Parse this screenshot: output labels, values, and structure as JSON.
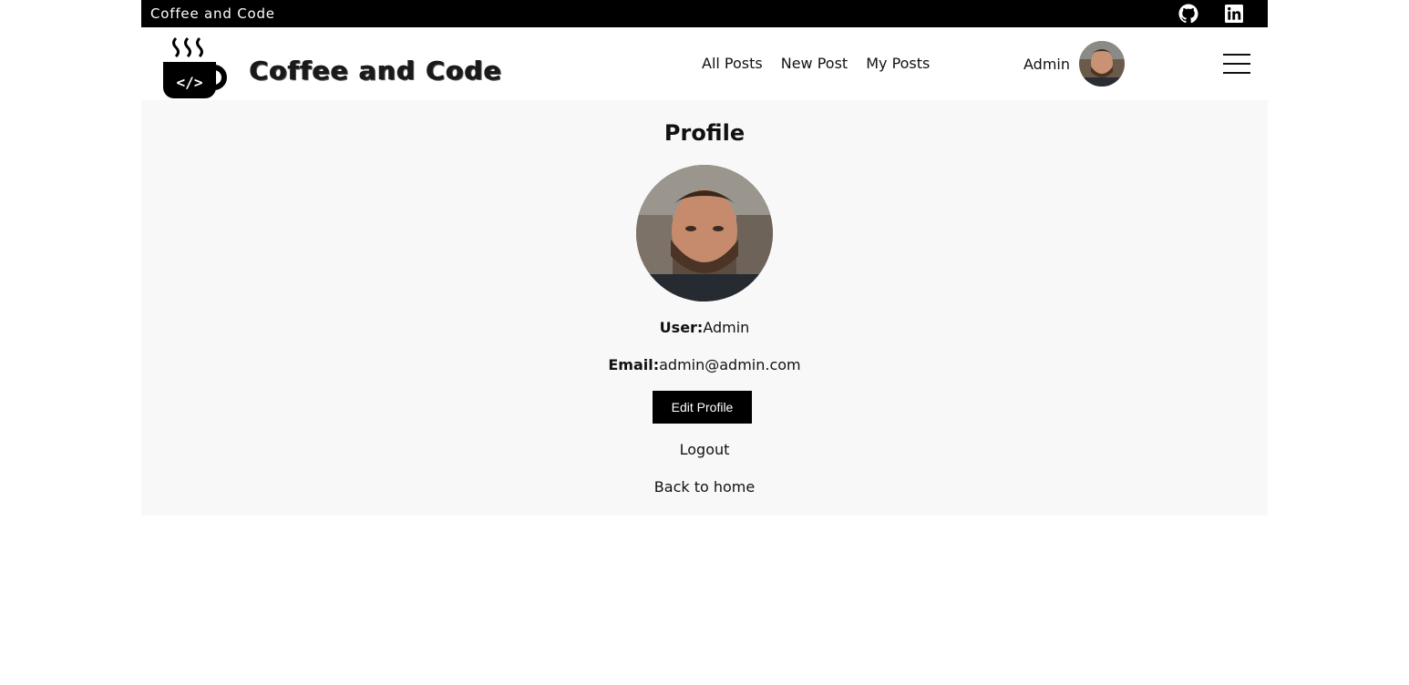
{
  "topbar": {
    "title": "Coffee and Code",
    "icons": [
      "github-icon",
      "linkedin-icon"
    ]
  },
  "header": {
    "brand": "Coffee and Code",
    "nav": [
      "All Posts",
      "New Post",
      "My Posts"
    ],
    "username": "Admin"
  },
  "profile": {
    "title": "Profile",
    "user_label": "User:",
    "user_value": "Admin",
    "email_label": "Email:",
    "email_value": "admin@admin.com",
    "edit_button": "Edit Profile",
    "logout": "Logout",
    "back_home": "Back to home"
  },
  "colors": {
    "topbar_bg": "#000000",
    "main_bg": "#f8f8f8",
    "button_bg": "#000000"
  }
}
